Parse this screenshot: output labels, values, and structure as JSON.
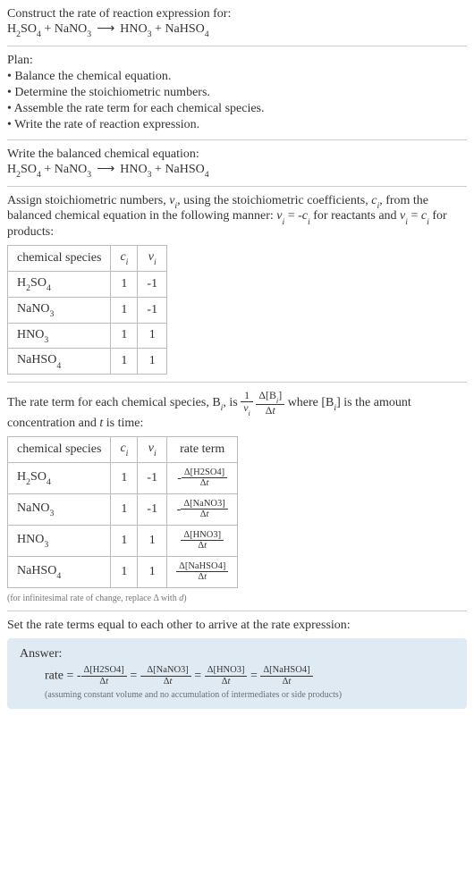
{
  "intro": {
    "prompt": "Construct the rate of reaction expression for:"
  },
  "eq": {
    "lhs1": "H",
    "lhs1s": "2",
    "lhs1b": "SO",
    "lhs1bs": "4",
    "lhs2": "NaNO",
    "lhs2s": "3",
    "arrow": "⟶",
    "rhs1": "HNO",
    "rhs1s": "3",
    "rhs2": "NaHSO",
    "rhs2s": "4",
    "plus": " + "
  },
  "plan": {
    "title": "Plan:",
    "b1": "• Balance the chemical equation.",
    "b2": "• Determine the stoichiometric numbers.",
    "b3": "• Assemble the rate term for each chemical species.",
    "b4": "• Write the rate of reaction expression."
  },
  "balanced": {
    "title": "Write the balanced chemical equation:"
  },
  "assign": {
    "t1": "Assign stoichiometric numbers, ",
    "nu": "ν",
    "i": "i",
    "t2": ", using the stoichiometric coefficients, ",
    "c": "c",
    "t3": ", from the balanced chemical equation in the following manner: ",
    "eqr": " = -",
    "t4": " for reactants and ",
    "eqp": " = ",
    "t5": " for products:"
  },
  "table1": {
    "h1": "chemical species",
    "h2": "c",
    "h2s": "i",
    "h3": "ν",
    "h3s": "i",
    "r1c1a": "H",
    "r1c1as": "2",
    "r1c1b": "SO",
    "r1c1bs": "4",
    "r1c2": "1",
    "r1c3": "-1",
    "r2c1": "NaNO",
    "r2c1s": "3",
    "r2c2": "1",
    "r2c3": "-1",
    "r3c1": "HNO",
    "r3c1s": "3",
    "r3c2": "1",
    "r3c3": "1",
    "r4c1": "NaHSO",
    "r4c1s": "4",
    "r4c2": "1",
    "r4c3": "1"
  },
  "rateterm": {
    "t1": "The rate term for each chemical species, B",
    "t2": ", is ",
    "one": "1",
    "nu": "ν",
    "i": "i",
    "dB": "Δ[B",
    "dBend": "]",
    "dt": "Δt",
    "t3": " where [B",
    "t4": "] is the amount concentration and ",
    "tvar": "t",
    "t5": " is time:"
  },
  "table2": {
    "h1": "chemical species",
    "h2": "c",
    "h2s": "i",
    "h3": "ν",
    "h3s": "i",
    "h4": "rate term",
    "r1c1a": "H",
    "r1c1as": "2",
    "r1c1b": "SO",
    "r1c1bs": "4",
    "r1c2": "1",
    "r1c3": "-1",
    "r1neg": "-",
    "r1num": "Δ[H2SO4]",
    "r1den": "Δt",
    "r2c1": "NaNO",
    "r2c1s": "3",
    "r2c2": "1",
    "r2c3": "-1",
    "r2neg": "-",
    "r2num": "Δ[NaNO3]",
    "r2den": "Δt",
    "r3c1": "HNO",
    "r3c1s": "3",
    "r3c2": "1",
    "r3c3": "1",
    "r3num": "Δ[HNO3]",
    "r3den": "Δt",
    "r4c1": "NaHSO",
    "r4c1s": "4",
    "r4c2": "1",
    "r4c3": "1",
    "r4num": "Δ[NaHSO4]",
    "r4den": "Δt"
  },
  "note1": "(for infinitesimal rate of change, replace Δ with d)",
  "setequal": "Set the rate terms equal to each other to arrive at the rate expression:",
  "answer": {
    "label": "Answer:",
    "rate": "rate = ",
    "neg": "-",
    "f1n": "Δ[H2SO4]",
    "f1d": "Δt",
    "eq": " = ",
    "f2n": "Δ[NaNO3]",
    "f2d": "Δt",
    "f3n": "Δ[HNO3]",
    "f3d": "Δt",
    "f4n": "Δ[NaHSO4]",
    "f4d": "Δt",
    "note": "(assuming constant volume and no accumulation of intermediates or side products)"
  }
}
